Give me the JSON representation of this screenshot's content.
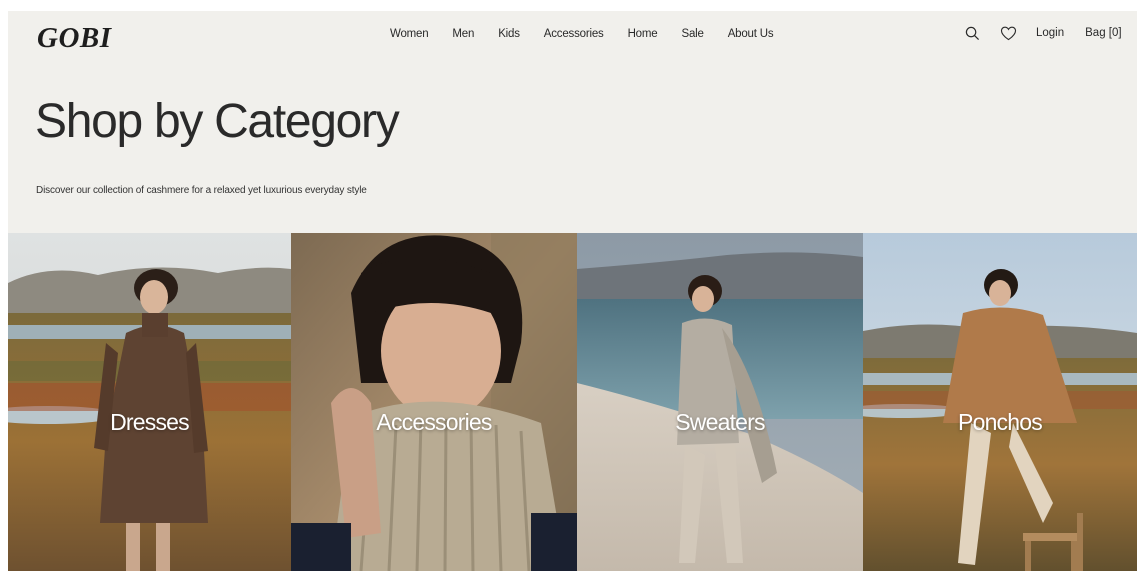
{
  "brand": {
    "logo": "GOBI"
  },
  "nav": {
    "items": [
      "Women",
      "Men",
      "Kids",
      "Accessories",
      "Home",
      "Sale",
      "About Us"
    ]
  },
  "header_actions": {
    "search_icon": "search-icon",
    "wishlist_icon": "heart-icon",
    "login_label": "Login",
    "bag_label": "Bag [0]"
  },
  "hero": {
    "title": "Shop by Category",
    "subtitle": "Discover our collection of cashmere for a relaxed yet luxurious everyday style"
  },
  "categories": [
    {
      "label": "Dresses"
    },
    {
      "label": "Accessories"
    },
    {
      "label": "Sweaters"
    },
    {
      "label": "Ponchos"
    }
  ],
  "colors": {
    "background": "#f1f0ec",
    "text": "#2a2a2a"
  }
}
